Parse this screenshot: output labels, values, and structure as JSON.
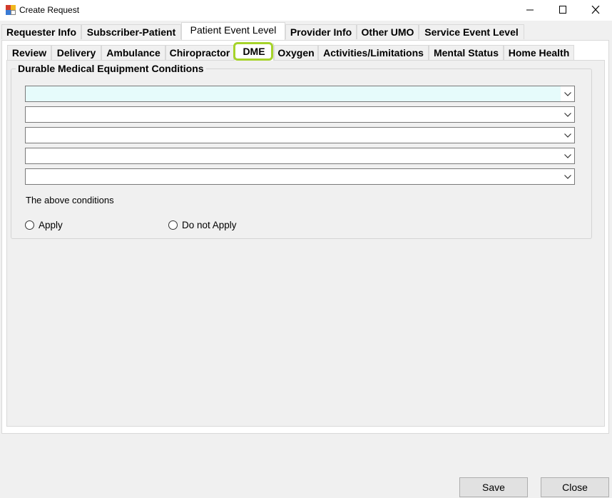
{
  "window": {
    "title": "Create Request",
    "icon": "app-form-icon",
    "controls": [
      "minimize-icon",
      "maximize-icon",
      "close-icon"
    ]
  },
  "main_tabs": [
    {
      "label": "Requester Info"
    },
    {
      "label": "Subscriber-Patient"
    },
    {
      "label": "Patient Event Level",
      "active": true
    },
    {
      "label": "Provider Info"
    },
    {
      "label": "Other UMO"
    },
    {
      "label": "Service Event Level"
    }
  ],
  "sub_tabs": [
    {
      "label": "Review"
    },
    {
      "label": "Delivery"
    },
    {
      "label": "Ambulance"
    },
    {
      "label": "Chiropractor"
    },
    {
      "label": "DME",
      "active": true
    },
    {
      "label": "Oxygen"
    },
    {
      "label": "Activities/Limitations"
    },
    {
      "label": "Mental Status"
    },
    {
      "label": "Home Health"
    }
  ],
  "dme_group": {
    "title": "Durable Medical Equipment Conditions",
    "conditions": [
      {
        "value": ""
      },
      {
        "value": ""
      },
      {
        "value": ""
      },
      {
        "value": ""
      },
      {
        "value": ""
      }
    ],
    "note": "The above conditions",
    "radios": {
      "apply": "Apply",
      "do_not_apply": "Do not Apply"
    }
  },
  "buttons": {
    "save": "Save",
    "close": "Close"
  },
  "colors": {
    "highlight": "#a6d32a",
    "focused_field": "#e6fbfb"
  }
}
